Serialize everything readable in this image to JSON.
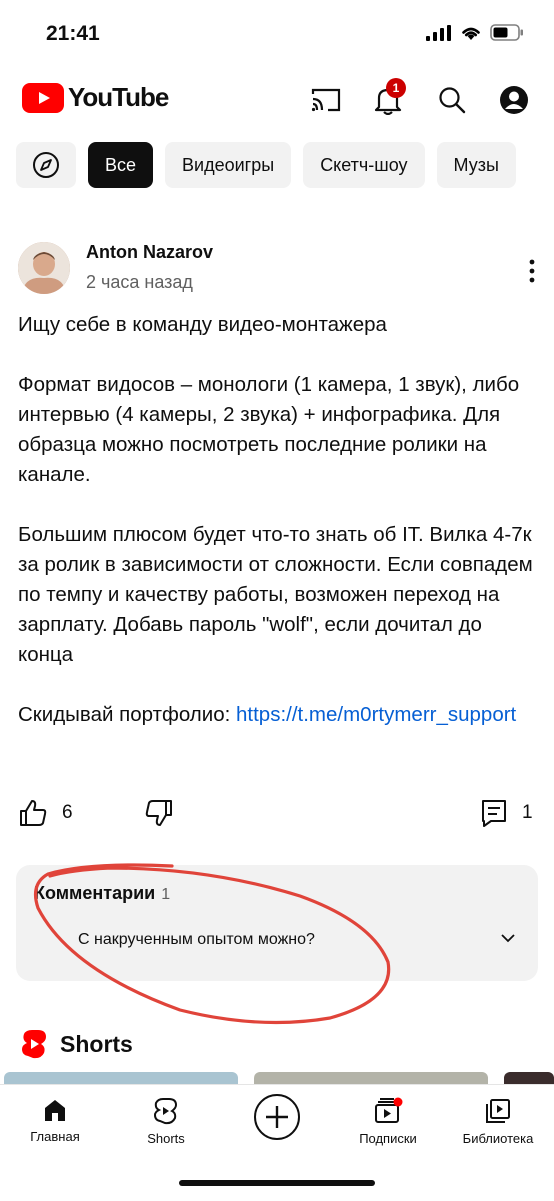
{
  "status": {
    "time": "21:41"
  },
  "header": {
    "logo_text": "YouTube",
    "notification_count": "1"
  },
  "chips": [
    {
      "label": "Все"
    },
    {
      "label": "Видеоигры"
    },
    {
      "label": "Скетч-шоу"
    },
    {
      "label": "Музы"
    }
  ],
  "post": {
    "author": "Anton Nazarov",
    "time_ago": "2 часа назад",
    "paragraphs": [
      "Ищу себе в команду видео-монтажера",
      "Формат видосов – монологи (1 камера, 1 звук), либо интервью (4 камеры, 2 звука) + инфографика. Для образца можно посмотреть последние ролики на канале.",
      "Большим плюсом будет что-то знать об IT. Вилка 4-7к за ролик в зависимости от сложности. Если совпадем по темпу и качеству работы, возможен переход на зарплату. Добавь пароль \"wolf\", если дочитал до конца"
    ],
    "portfolio_prefix": "Скидывай портфолио: ",
    "portfolio_link": "https://t.me/m0rtymerr_support",
    "likes": "6",
    "comments_count": "1"
  },
  "comments": {
    "title": "Комментарии",
    "count": "1",
    "top_comment": "С накрученным опытом можно?"
  },
  "shorts": {
    "title": "Shorts"
  },
  "nav": [
    {
      "label": "Главная"
    },
    {
      "label": "Shorts"
    },
    {
      "label": "Подписки"
    },
    {
      "label": "Библиотека"
    }
  ],
  "colors": {
    "brand_red": "#ff0000",
    "badge_red": "#cc0000",
    "link": "#065fd4",
    "annotation": "#e0443a"
  }
}
